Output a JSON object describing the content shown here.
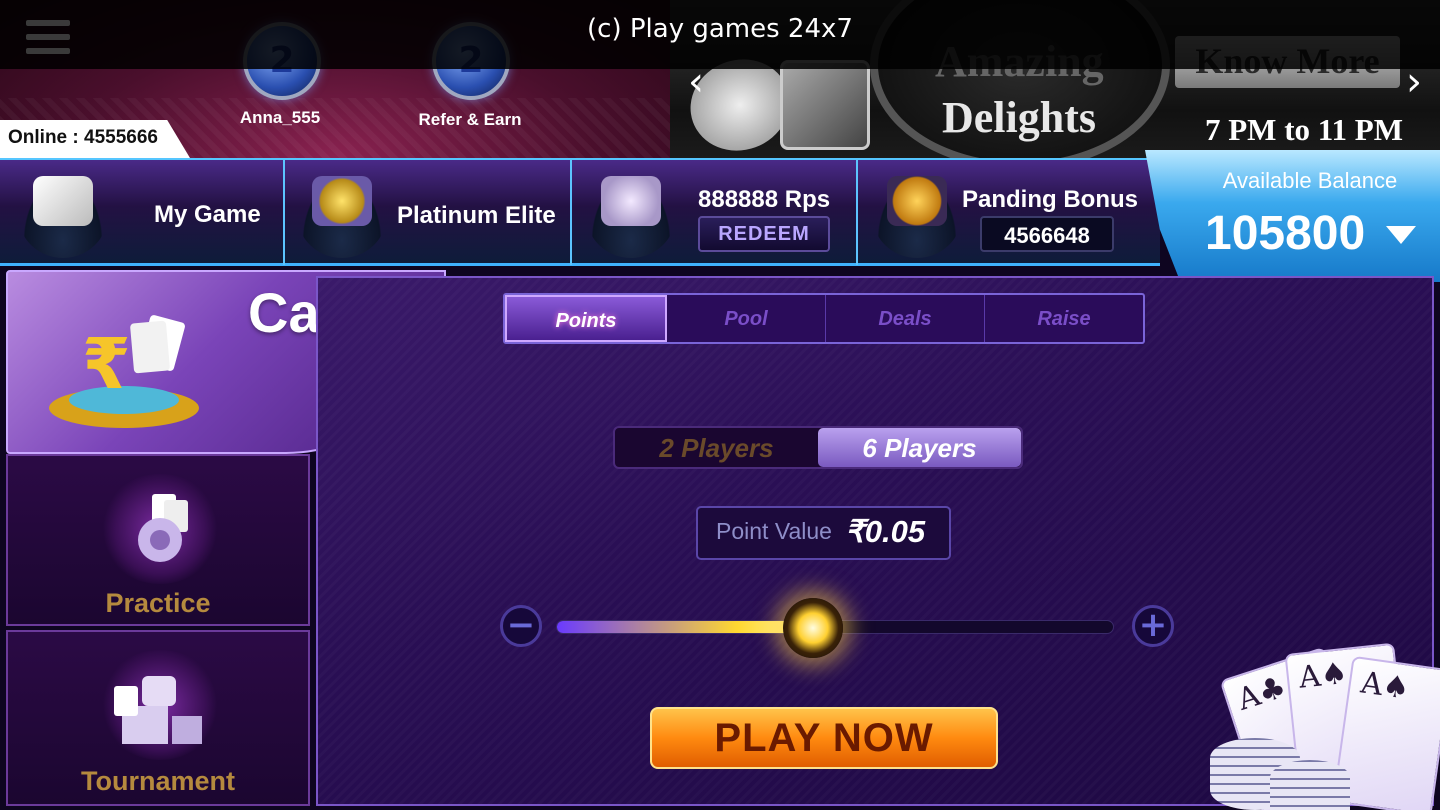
{
  "titlebar": {
    "text": "(c) Play games 24x7"
  },
  "profile": {
    "username": "Anna_555",
    "refer_label": "Refer & Earn",
    "online_text": "Online : 4555666"
  },
  "banner": {
    "title_faded": "Amazing",
    "title": "Delights",
    "button": "Know More",
    "time": "7 PM to 11 PM"
  },
  "stats": {
    "my_game": "My Game",
    "tier": "Platinum Elite",
    "rps": "888888 Rps",
    "redeem": "REDEEM",
    "bonus_label": "Panding Bonus",
    "bonus_value": "4566648"
  },
  "balance": {
    "label": "Available Balance",
    "value": "105800"
  },
  "left_menu": {
    "cash": "Cash",
    "practice": "Practice",
    "tournament": "Tournament"
  },
  "tabs": [
    "Points",
    "Pool",
    "Deals",
    "Raise"
  ],
  "active_tab": "Points",
  "players": {
    "two": "2 Players",
    "six": "6 Players",
    "selected": "6 Players"
  },
  "point_value": {
    "label": "Point Value",
    "value": "₹0.05"
  },
  "slider": {
    "level": 0.46
  },
  "play_button": "PLAY NOW",
  "icons": {
    "minus": "−",
    "plus": "+",
    "prev": "‹",
    "next": "›"
  },
  "colors": {
    "accent_blue": "#3fb2ff",
    "purple": "#2a0f55",
    "orange": "#ff8a10"
  }
}
